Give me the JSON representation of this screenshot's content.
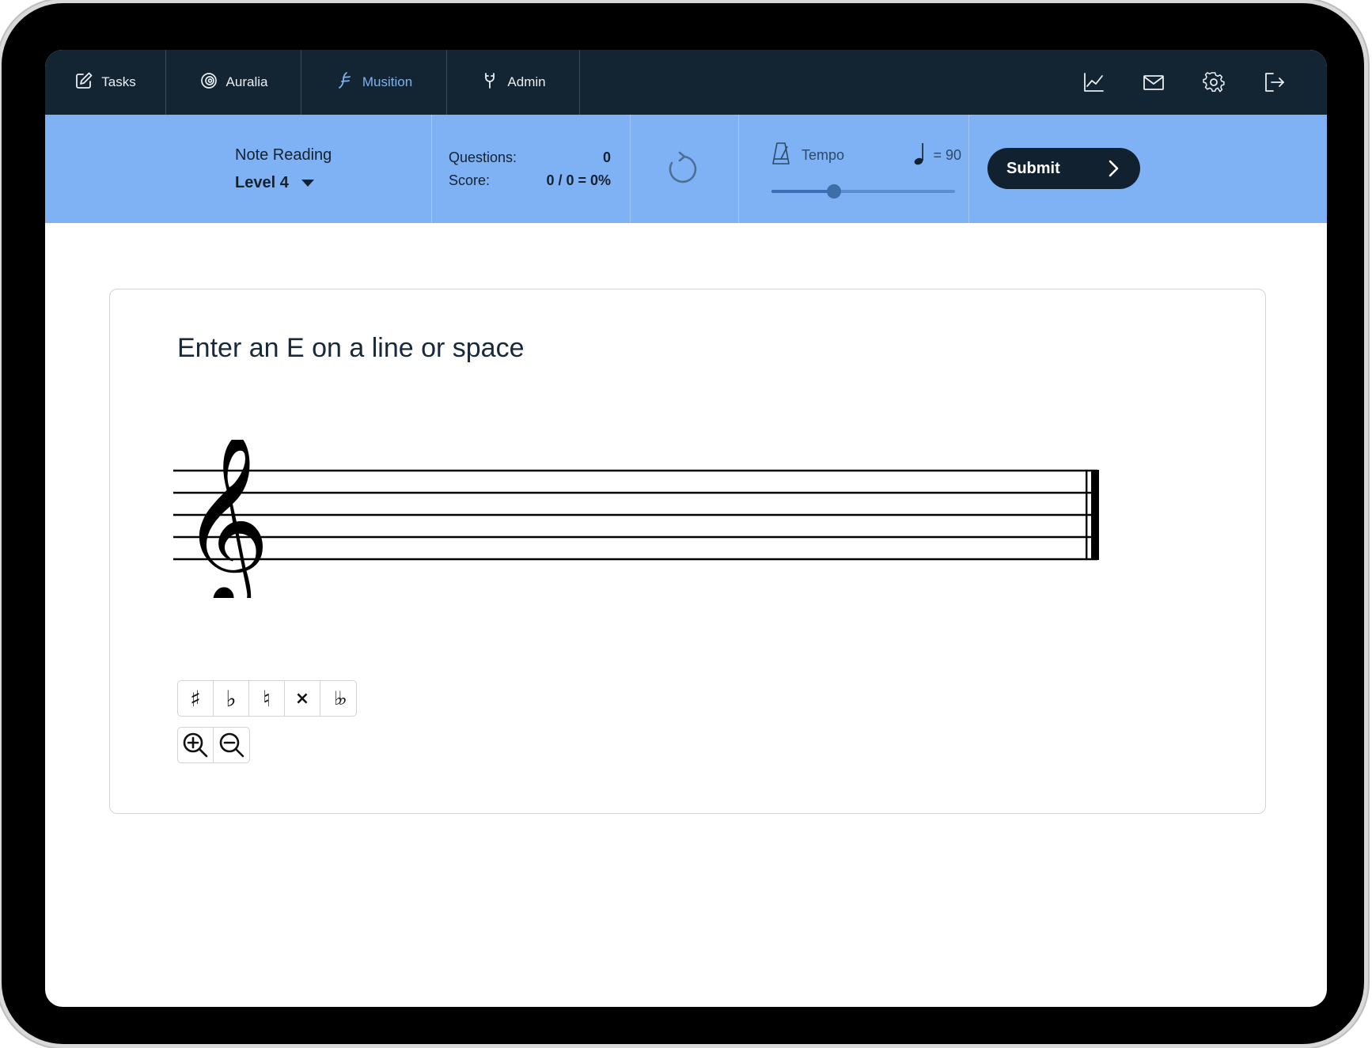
{
  "nav": {
    "tabs": [
      {
        "label": "Tasks",
        "icon": "edit-icon"
      },
      {
        "label": "Auralia",
        "icon": "auralia-logo-icon"
      },
      {
        "label": "Musition",
        "icon": "musition-logo-icon",
        "active": true
      },
      {
        "label": "Admin",
        "icon": "admin-icon"
      }
    ],
    "right_icons": [
      "chart-icon",
      "mail-icon",
      "gear-icon",
      "logout-icon"
    ]
  },
  "toolbar": {
    "task_name": "Note Reading",
    "level": "Level 4",
    "questions_label": "Questions:",
    "questions_value": "0",
    "score_label": "Score:",
    "score_value": "0 / 0 = 0%",
    "tempo_label": "Tempo",
    "tempo_value": "= 90",
    "tempo_slider_fraction": 0.34,
    "submit_label": "Submit"
  },
  "question": {
    "prompt": "Enter an E on a line or space",
    "clef": "treble"
  },
  "accidentals": [
    {
      "name": "sharp",
      "symbol": "♯"
    },
    {
      "name": "flat",
      "symbol": "♭"
    },
    {
      "name": "natural",
      "symbol": "♮"
    },
    {
      "name": "double-sharp",
      "symbol": "×"
    },
    {
      "name": "double-flat",
      "symbol": "♭♭"
    }
  ],
  "colors": {
    "nav_bg": "#132433",
    "toolbar_bg": "#7fb2f5",
    "accent": "#7fb1ef",
    "submit_bg": "#122130"
  }
}
